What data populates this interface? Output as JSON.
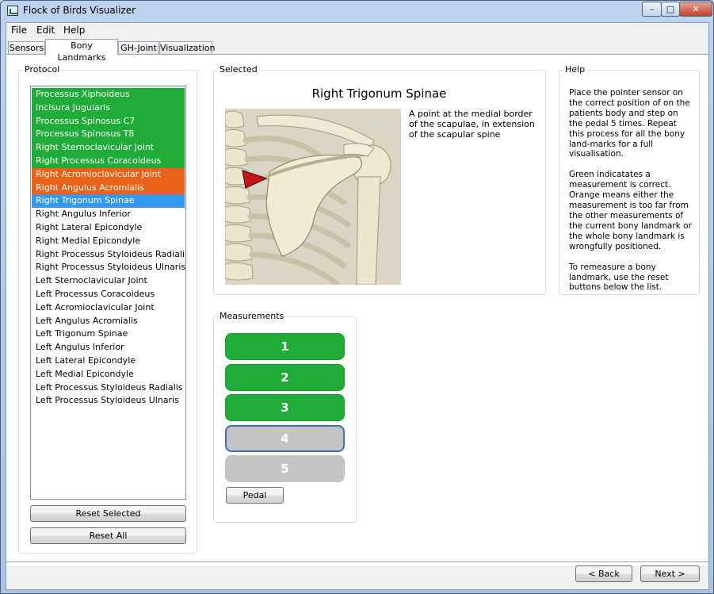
{
  "window": {
    "title": "Flock of Birds Visualizer",
    "min_glyph": "–",
    "max_glyph": "□",
    "close_glyph": "✕"
  },
  "menu": [
    "File",
    "Edit",
    "Help"
  ],
  "tabs": [
    "Sensors",
    "Bony Landmarks",
    "GH-Joint",
    "Visualization"
  ],
  "protocol": {
    "title": "Protocol",
    "items": [
      {
        "label": "Processus Xiphoideus",
        "status": "green"
      },
      {
        "label": "Incisura Jugularis",
        "status": "green"
      },
      {
        "label": "Processus Spinosus C7",
        "status": "green"
      },
      {
        "label": "Processus Spinosus T8",
        "status": "green"
      },
      {
        "label": "Right Sternoclavicular Joint",
        "status": "green"
      },
      {
        "label": "Right Processus Coracoideus",
        "status": "green"
      },
      {
        "label": "Right Acromioclavicular Joint",
        "status": "orange"
      },
      {
        "label": "Right Angulus Acromialis",
        "status": "orange"
      },
      {
        "label": "Right Trigonum Spinae",
        "status": "blue"
      },
      {
        "label": "Right Angulus Inferior",
        "status": "none"
      },
      {
        "label": "Right Lateral Epicondyle",
        "status": "none"
      },
      {
        "label": "Right Medial Epicondyle",
        "status": "none"
      },
      {
        "label": "Right Processus Styloideus Radialis",
        "status": "none"
      },
      {
        "label": "Right Processus Styloideus Ulnaris",
        "status": "none"
      },
      {
        "label": "Left Sternoclavicular Joint",
        "status": "none"
      },
      {
        "label": "Left Processus Coracoideus",
        "status": "none"
      },
      {
        "label": "Left Acromioclavicular Joint",
        "status": "none"
      },
      {
        "label": "Left Angulus Acromialis",
        "status": "none"
      },
      {
        "label": "Left Trigonum Spinae",
        "status": "none"
      },
      {
        "label": "Left Angulus Inferior",
        "status": "none"
      },
      {
        "label": "Left Lateral Epicondyle",
        "status": "none"
      },
      {
        "label": "Left Medial Epicondyle",
        "status": "none"
      },
      {
        "label": "Left Processus Styloideus Radialis",
        "status": "none"
      },
      {
        "label": "Left Processus Styloideus Ulnaris",
        "status": "none"
      }
    ],
    "reset_selected": "Reset Selected",
    "reset_all": "Reset All"
  },
  "selected": {
    "title": "Selected",
    "landmark_name": "Right Trigonum Spinae",
    "description": "A point at the medial border of the scapulae, in extension of the scapular spine"
  },
  "help": {
    "title": "Help",
    "paragraphs": [
      "Place the pointer sensor on the correct position of on the patients body and step on the pedal 5 times. Repeat this process for all the bony land-marks for a full visualisation.",
      "Green indicatates a measurement is correct. Orange means either the measurement is too far from the other measurements of the current bony landmark or the whole bony landmark is wrongfully positioned.",
      "To remeasure a bony landmark, use the reset buttons below the list."
    ]
  },
  "measurements": {
    "title": "Measurements",
    "buttons": [
      {
        "label": "1",
        "state": "done"
      },
      {
        "label": "2",
        "state": "done"
      },
      {
        "label": "3",
        "state": "done"
      },
      {
        "label": "4",
        "state": "current"
      },
      {
        "label": "5",
        "state": "pending"
      }
    ],
    "pedal_label": "Pedal"
  },
  "nav": {
    "back_label": "< Back",
    "next_label": "Next >"
  },
  "colors": {
    "green": "#1fac38",
    "orange": "#ea6218",
    "blue": "#3399ee",
    "pending": "#c4c4c4"
  }
}
